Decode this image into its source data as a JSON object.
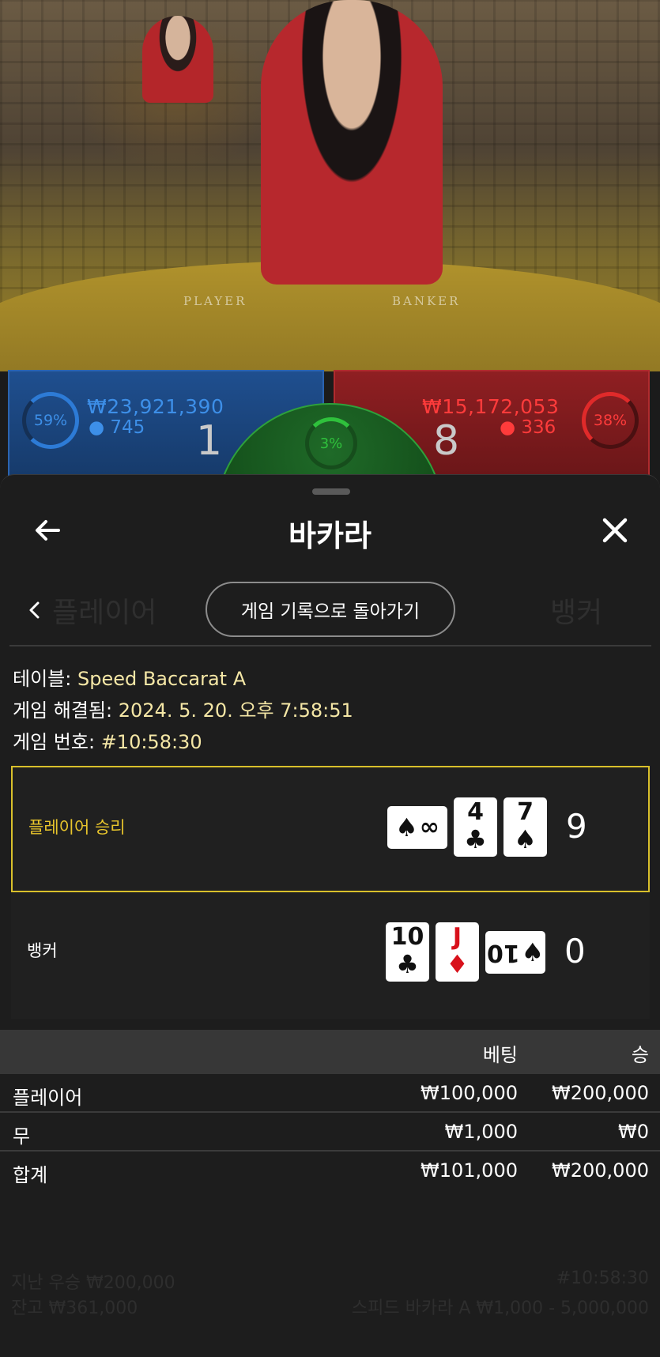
{
  "video": {
    "felt_player": "PLAYER",
    "felt_banker": "BANKER"
  },
  "bet_bar": {
    "player": {
      "percent": "59%",
      "amount": "₩23,921,390",
      "count": "745",
      "score": "1"
    },
    "tie": {
      "percent": "3%"
    },
    "banker": {
      "percent": "38%",
      "amount": "₩15,172,053",
      "count": "336",
      "score": "8"
    }
  },
  "sheet": {
    "title": "바카라",
    "back_to_history": "게임 기록으로 돌아가기",
    "ghost_player": "플레이어",
    "ghost_banker": "뱅커",
    "info": {
      "table_label": "테이블:",
      "table_value": "Speed Baccarat A",
      "resolved_label": "게임 해결됨:",
      "resolved_value": "2024. 5. 20. 오후 7:58:51",
      "number_label": "게임 번호:",
      "number_value": "#10:58:30"
    },
    "player_result": {
      "label": "플레이어 승리",
      "cards": [
        {
          "rank": "∞",
          "suit": "♠",
          "color": "black",
          "sideways": true
        },
        {
          "rank": "4",
          "suit": "♣",
          "color": "black",
          "sideways": false
        },
        {
          "rank": "7",
          "suit": "♠",
          "color": "black",
          "sideways": false
        }
      ],
      "total": "9"
    },
    "banker_result": {
      "label": "뱅커",
      "cards": [
        {
          "rank": "10",
          "suit": "♣",
          "color": "black",
          "sideways": false
        },
        {
          "rank": "J",
          "suit": "♦",
          "color": "red",
          "sideways": false
        },
        {
          "rank": "10",
          "suit": "♠",
          "color": "black",
          "sideways": true
        }
      ],
      "total": "0"
    },
    "bets": {
      "headers": {
        "bet": "베팅",
        "win": "승"
      },
      "rows": [
        {
          "name": "플레이어",
          "bet": "₩100,000",
          "win": "₩200,000"
        },
        {
          "name": "무",
          "bet": "₩1,000",
          "win": "₩0"
        },
        {
          "name": "합계",
          "bet": "₩101,000",
          "win": "₩200,000"
        }
      ]
    },
    "faded_footer": {
      "last_win": "지난 우승 ₩200,000",
      "balance": "잔고 ₩361,000",
      "game_id": "#10:58:30",
      "table_limits": "스피드 바카라 A ₩1,000 - 5,000,000"
    }
  },
  "colors": {
    "accent_gold": "#d9c02b",
    "player_blue": "#2d7bd6",
    "banker_red": "#e02a2a",
    "tie_green": "#2fc13c"
  }
}
